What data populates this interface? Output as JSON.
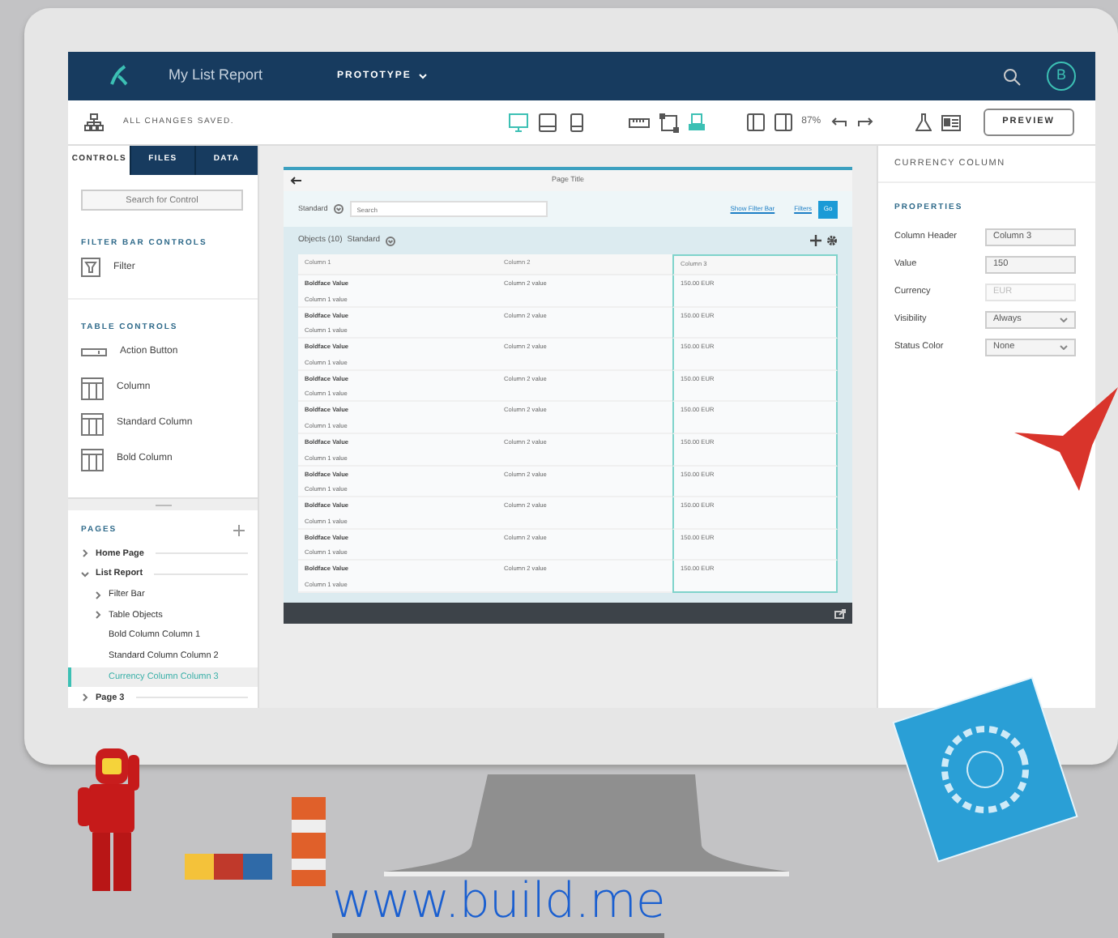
{
  "header": {
    "app_title": "My List Report",
    "mode_menu": "PROTOTYPE",
    "avatar": "B"
  },
  "toolbar": {
    "status": "ALL CHANGES SAVED.",
    "devices": [
      {
        "kind": "desktop",
        "selected": true
      },
      {
        "kind": "tablet",
        "selected": false
      },
      {
        "kind": "phone",
        "selected": false
      }
    ],
    "zoom": "87%",
    "preview_button": "PREVIEW"
  },
  "left_panel": {
    "tabs": [
      {
        "label": "CONTROLS",
        "selected": true
      },
      {
        "label": "FILES",
        "selected": false
      },
      {
        "label": "DATA",
        "selected": false
      }
    ],
    "search": {
      "placeholder": "Search for Control"
    },
    "sections": [
      {
        "title": "FILTER BAR CONTROLS",
        "items": [
          {
            "kind": "filter",
            "label": "Filter"
          }
        ]
      },
      {
        "title": "TABLE CONTROLS",
        "items": [
          {
            "kind": "button",
            "label": "Action Button"
          },
          {
            "kind": "column",
            "label": "Column"
          },
          {
            "kind": "column",
            "label": "Standard Column"
          },
          {
            "kind": "column",
            "label": "Bold Column"
          }
        ]
      }
    ],
    "pages": {
      "title": "PAGES",
      "tree": [
        {
          "label": "Home Page",
          "expanded": false,
          "selected": false
        },
        {
          "label": "List Report",
          "expanded": true,
          "selected": false,
          "children": [
            {
              "label": "Filter Bar",
              "expanded": false,
              "selected": false
            },
            {
              "label": "Table Objects",
              "expanded": false,
              "selected": false
            },
            {
              "label": "Bold Column Column 1",
              "selected": false
            },
            {
              "label": "Standard Column Column 2",
              "selected": false
            },
            {
              "label": "Currency Column Column 3",
              "selected": true
            }
          ]
        },
        {
          "label": "Page 3",
          "expanded": false,
          "selected": false
        }
      ]
    }
  },
  "preview": {
    "page_title": "Page Title",
    "filter_bar": {
      "variant": "Standard",
      "search": {
        "placeholder": "Search"
      },
      "show_filter_bar": "Show Filter Bar",
      "filters": "Filters",
      "go": "Go"
    },
    "table": {
      "title": "Objects (10)",
      "variant": "Standard",
      "columns": [
        {
          "label": "Column 1",
          "selected": false
        },
        {
          "label": "Column 2",
          "selected": false
        },
        {
          "label": "Column 3",
          "selected": true
        }
      ],
      "rows": [
        {
          "bold": "Boldface Value",
          "sub": "Column 1 value",
          "column_2": "Column 2 value",
          "column_3": "150.00 EUR"
        },
        {
          "bold": "Boldface Value",
          "sub": "Column 1 value",
          "column_2": "Column 2 value",
          "column_3": "150.00 EUR"
        },
        {
          "bold": "Boldface Value",
          "sub": "Column 1 value",
          "column_2": "Column 2 value",
          "column_3": "150.00 EUR"
        },
        {
          "bold": "Boldface Value",
          "sub": "Column 1 value",
          "column_2": "Column 2 value",
          "column_3": "150.00 EUR"
        },
        {
          "bold": "Boldface Value",
          "sub": "Column 1 value",
          "column_2": "Column 2 value",
          "column_3": "150.00 EUR"
        },
        {
          "bold": "Boldface Value",
          "sub": "Column 1 value",
          "column_2": "Column 2 value",
          "column_3": "150.00 EUR"
        },
        {
          "bold": "Boldface Value",
          "sub": "Column 1 value",
          "column_2": "Column 2 value",
          "column_3": "150.00 EUR"
        },
        {
          "bold": "Boldface Value",
          "sub": "Column 1 value",
          "column_2": "Column 2 value",
          "column_3": "150.00 EUR"
        },
        {
          "bold": "Boldface Value",
          "sub": "Column 1 value",
          "column_2": "Column 2 value",
          "column_3": "150.00 EUR"
        },
        {
          "bold": "Boldface Value",
          "sub": "Column 1 value",
          "column_2": "Column 2 value",
          "column_3": "150.00 EUR"
        }
      ]
    }
  },
  "right_panel": {
    "title": "CURRENCY COLUMN",
    "section": "PROPERTIES",
    "fields": [
      {
        "kind": "text",
        "label": "Column Header",
        "value": "Column 3",
        "disabled": false
      },
      {
        "kind": "text",
        "label": "Value",
        "value": "150",
        "disabled": false
      },
      {
        "kind": "text",
        "label": "Currency",
        "value": "EUR",
        "disabled": true
      },
      {
        "kind": "select",
        "label": "Visibility",
        "value": "Always",
        "disabled": false
      },
      {
        "kind": "select",
        "label": "Status Color",
        "value": "None",
        "disabled": false
      }
    ]
  },
  "caption": "www.build.me"
}
